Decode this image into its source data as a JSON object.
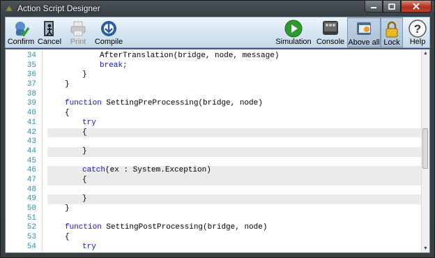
{
  "window": {
    "title": "Action Script Designer"
  },
  "toolbar": {
    "left": [
      {
        "name": "confirm",
        "label": "Confirm",
        "icon": "confirm-icon"
      },
      {
        "name": "cancel",
        "label": "Cancel",
        "icon": "cancel-icon"
      },
      {
        "name": "print",
        "label": "Print",
        "icon": "print-icon",
        "disabled": true
      },
      {
        "name": "compile",
        "label": "Compile",
        "icon": "compile-icon"
      }
    ],
    "right": [
      {
        "name": "simulation",
        "label": "Simulation",
        "icon": "play-icon"
      },
      {
        "name": "console",
        "label": "Console",
        "icon": "console-icon"
      },
      {
        "name": "above-all",
        "label": "Above all",
        "icon": "above-all-icon",
        "pressed": true
      },
      {
        "name": "lock",
        "label": "Lock",
        "icon": "lock-icon",
        "pressed": true
      },
      {
        "name": "help",
        "label": "Help",
        "icon": "help-icon"
      }
    ]
  },
  "editor": {
    "lines": [
      {
        "n": "34",
        "indent": 4,
        "text": "AfterTranslation(bridge, node, message)",
        "kw": false
      },
      {
        "n": "35",
        "indent": 4,
        "text": "break;",
        "kw": true
      },
      {
        "n": "36",
        "indent": 3,
        "text": "}",
        "kw": false
      },
      {
        "n": "37",
        "indent": 2,
        "text": "}",
        "kw": false
      },
      {
        "n": "38",
        "indent": 0,
        "text": "",
        "kw": false
      },
      {
        "n": "39",
        "indent": 2,
        "text": "function SettingPreProcessing(bridge, node)",
        "kw": "function"
      },
      {
        "n": "40",
        "indent": 2,
        "text": "{",
        "kw": false
      },
      {
        "n": "41",
        "indent": 3,
        "text": "try",
        "kw": true
      },
      {
        "n": "42",
        "indent": 3,
        "text": "{",
        "kw": false,
        "shade": true
      },
      {
        "n": "43",
        "indent": 0,
        "text": "",
        "kw": false,
        "cur": true
      },
      {
        "n": "44",
        "indent": 3,
        "text": "}",
        "kw": false,
        "shade": true
      },
      {
        "n": "45",
        "indent": 0,
        "text": "",
        "kw": false
      },
      {
        "n": "46",
        "indent": 3,
        "text": "catch(ex : System.Exception)",
        "kw": "catch",
        "shade": true
      },
      {
        "n": "47",
        "indent": 3,
        "text": "{",
        "kw": false,
        "shade": true
      },
      {
        "n": "48",
        "indent": 0,
        "text": "",
        "kw": false,
        "cur": true
      },
      {
        "n": "49",
        "indent": 3,
        "text": "}",
        "kw": false,
        "shade": true
      },
      {
        "n": "50",
        "indent": 2,
        "text": "}",
        "kw": false
      },
      {
        "n": "51",
        "indent": 0,
        "text": "",
        "kw": false
      },
      {
        "n": "52",
        "indent": 2,
        "text": "function SettingPostProcessing(bridge, node)",
        "kw": "function"
      },
      {
        "n": "53",
        "indent": 2,
        "text": "{",
        "kw": false
      },
      {
        "n": "54",
        "indent": 3,
        "text": "try",
        "kw": true
      }
    ]
  },
  "colors": {
    "keyword": "#1515c8",
    "line_number": "#2b91af",
    "toolbar_bg": "#d6e5f2"
  }
}
